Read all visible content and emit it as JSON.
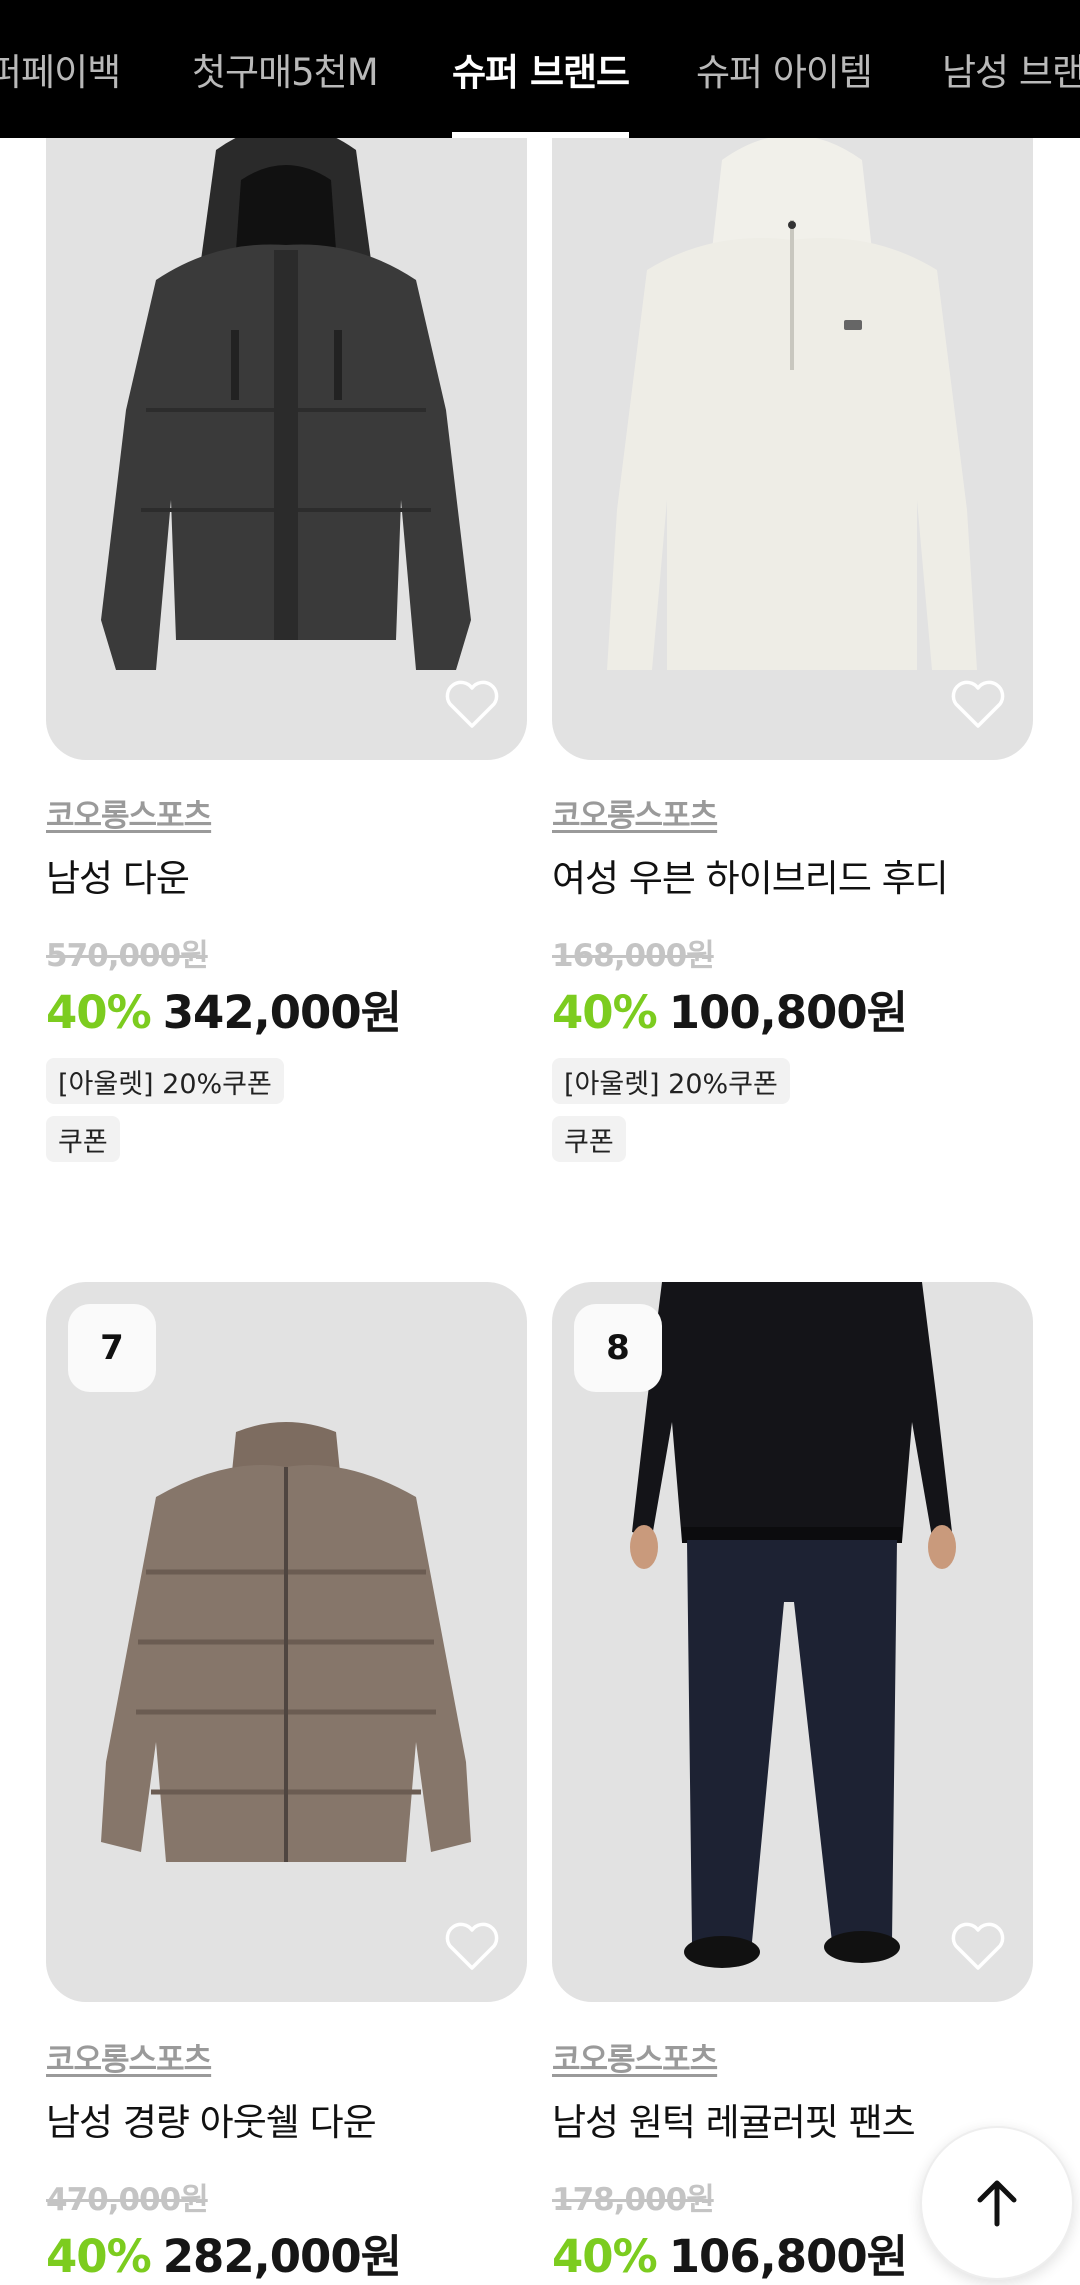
{
  "tabs": [
    {
      "label": "퍼페이백",
      "active": false
    },
    {
      "label": "첫구매5천M",
      "active": false
    },
    {
      "label": "슈퍼 브랜드",
      "active": true
    },
    {
      "label": "슈퍼 아이템",
      "active": false
    },
    {
      "label": "남성 브랜",
      "active": false
    }
  ],
  "products": [
    {
      "rank": "",
      "brand": "코오롱스포츠",
      "name": "남성 다운",
      "original_price": "570,000원",
      "discount": "40%",
      "price": "342,000원",
      "coupons": [
        "[아울렛] 20%쿠폰",
        "쿠폰"
      ],
      "image": "dark-down-jacket"
    },
    {
      "rank": "",
      "brand": "코오롱스포츠",
      "name": "여성 우븐 하이브리드 후디",
      "original_price": "168,000원",
      "discount": "40%",
      "price": "100,800원",
      "coupons": [
        "[아울렛] 20%쿠폰",
        "쿠폰"
      ],
      "image": "white-hoodie"
    },
    {
      "rank": "7",
      "brand": "코오롱스포츠",
      "name": "남성 경량 아웃쉘 다운",
      "original_price": "470,000원",
      "discount": "40%",
      "price": "282,000원",
      "coupons": [],
      "image": "brown-puffer"
    },
    {
      "rank": "8",
      "brand": "코오롱스포츠",
      "name": "남성 원턱 레귤러핏 팬츠",
      "original_price": "178,000원",
      "discount": "40%",
      "price": "106,800원",
      "coupons": [],
      "image": "navy-pants"
    }
  ],
  "icons": {
    "wishlist": "heart-outline-icon",
    "scroll_top": "arrow-up-icon"
  },
  "colors": {
    "discount": "#7ccc1f",
    "tab_bar": "#000000",
    "image_bg": "#e2e2e2"
  }
}
